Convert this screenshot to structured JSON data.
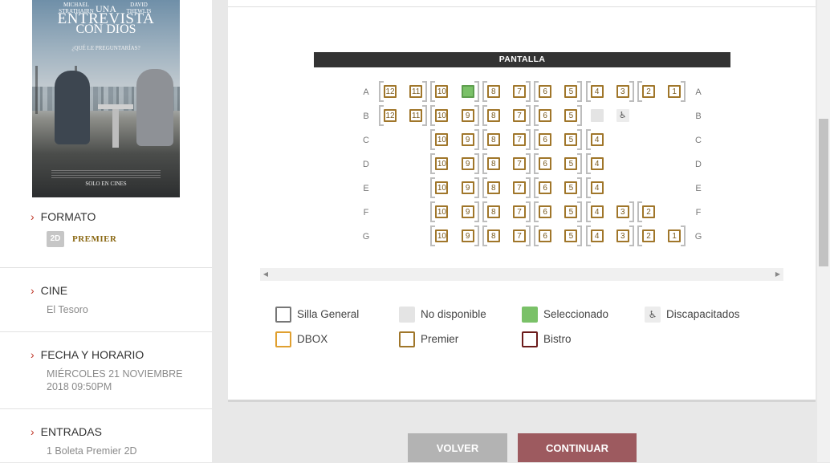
{
  "poster": {
    "actor_left": "MICHAEL STRATHAIRN",
    "actor_right": "DAVID THEWLIS",
    "title_line1": "UNA",
    "title_line2": "ENTREVISTA",
    "title_line3": "CON DIOS",
    "tagline": "¿QUÉ LE PREGUNTARÍAS?",
    "release": "SOLO EN CINES"
  },
  "sidebar": {
    "formato": {
      "heading": "FORMATO",
      "badge": "2D",
      "type": "PREMIER"
    },
    "cine": {
      "heading": "CINE",
      "value": "El Tesoro"
    },
    "fecha": {
      "heading": "FECHA Y HORARIO",
      "line1": "MIÉRCOLES 21 NOVIEMBRE",
      "line2": "2018 09:50PM"
    },
    "entradas": {
      "heading": "ENTRADAS",
      "value": "1 Boleta Premier 2D"
    },
    "chevron": "›"
  },
  "seatmap": {
    "screen_label": "PANTALLA",
    "rows": [
      {
        "label": "A",
        "seats": [
          {
            "n": "12",
            "s": "available"
          },
          {
            "n": "11",
            "s": "available"
          },
          {
            "n": "10",
            "s": "available"
          },
          {
            "n": "9",
            "s": "selected"
          },
          {
            "n": "8",
            "s": "available"
          },
          {
            "n": "7",
            "s": "available"
          },
          {
            "n": "6",
            "s": "available"
          },
          {
            "n": "5",
            "s": "available"
          },
          {
            "n": "4",
            "s": "available"
          },
          {
            "n": "3",
            "s": "available"
          },
          {
            "n": "2",
            "s": "available"
          },
          {
            "n": "1",
            "s": "available"
          }
        ]
      },
      {
        "label": "B",
        "seats": [
          {
            "n": "12",
            "s": "available"
          },
          {
            "n": "11",
            "s": "available"
          },
          {
            "n": "10",
            "s": "available"
          },
          {
            "n": "9",
            "s": "available"
          },
          {
            "n": "8",
            "s": "available"
          },
          {
            "n": "7",
            "s": "available"
          },
          {
            "n": "6",
            "s": "available"
          },
          {
            "n": "5",
            "s": "available"
          },
          {
            "n": "",
            "s": "unavailable"
          },
          {
            "n": "♿",
            "s": "disabled"
          }
        ]
      },
      {
        "label": "C",
        "seats": [
          {
            "n": "10",
            "s": "available"
          },
          {
            "n": "9",
            "s": "available"
          },
          {
            "n": "8",
            "s": "available"
          },
          {
            "n": "7",
            "s": "available"
          },
          {
            "n": "6",
            "s": "available"
          },
          {
            "n": "5",
            "s": "available"
          },
          {
            "n": "4",
            "s": "available"
          }
        ]
      },
      {
        "label": "D",
        "seats": [
          {
            "n": "10",
            "s": "available"
          },
          {
            "n": "9",
            "s": "available"
          },
          {
            "n": "8",
            "s": "available"
          },
          {
            "n": "7",
            "s": "available"
          },
          {
            "n": "6",
            "s": "available"
          },
          {
            "n": "5",
            "s": "available"
          },
          {
            "n": "4",
            "s": "available"
          }
        ]
      },
      {
        "label": "E",
        "seats": [
          {
            "n": "10",
            "s": "available"
          },
          {
            "n": "9",
            "s": "available"
          },
          {
            "n": "8",
            "s": "available"
          },
          {
            "n": "7",
            "s": "available"
          },
          {
            "n": "6",
            "s": "available"
          },
          {
            "n": "5",
            "s": "available"
          },
          {
            "n": "4",
            "s": "available"
          }
        ]
      },
      {
        "label": "F",
        "seats": [
          {
            "n": "10",
            "s": "available"
          },
          {
            "n": "9",
            "s": "available"
          },
          {
            "n": "8",
            "s": "available"
          },
          {
            "n": "7",
            "s": "available"
          },
          {
            "n": "6",
            "s": "available"
          },
          {
            "n": "5",
            "s": "available"
          },
          {
            "n": "4",
            "s": "available"
          },
          {
            "n": "3",
            "s": "available"
          },
          {
            "n": "2",
            "s": "available"
          }
        ]
      },
      {
        "label": "G",
        "seats": [
          {
            "n": "10",
            "s": "available"
          },
          {
            "n": "9",
            "s": "available"
          },
          {
            "n": "8",
            "s": "available"
          },
          {
            "n": "7",
            "s": "available"
          },
          {
            "n": "6",
            "s": "available"
          },
          {
            "n": "5",
            "s": "available"
          },
          {
            "n": "4",
            "s": "available"
          },
          {
            "n": "3",
            "s": "available"
          },
          {
            "n": "2",
            "s": "available"
          },
          {
            "n": "1",
            "s": "available"
          }
        ]
      }
    ]
  },
  "legend": {
    "general": "Silla General",
    "unavailable": "No disponible",
    "selected": "Seleccionado",
    "disabled": "Discapacitados",
    "disabled_icon": "♿",
    "dbox": "DBOX",
    "premier": "Premier",
    "bistro": "Bistro"
  },
  "colors": {
    "premier": "#a0762a",
    "dbox": "#e0a030",
    "bistro": "#6b1a1a",
    "selected": "#7ac168",
    "continue_button": "#9d5a5f",
    "back_button": "#b3b3b3"
  },
  "buttons": {
    "back": "VOLVER",
    "continue": "CONTINUAR"
  },
  "icons": {
    "scroll_left": "◀",
    "scroll_right": "▶"
  }
}
